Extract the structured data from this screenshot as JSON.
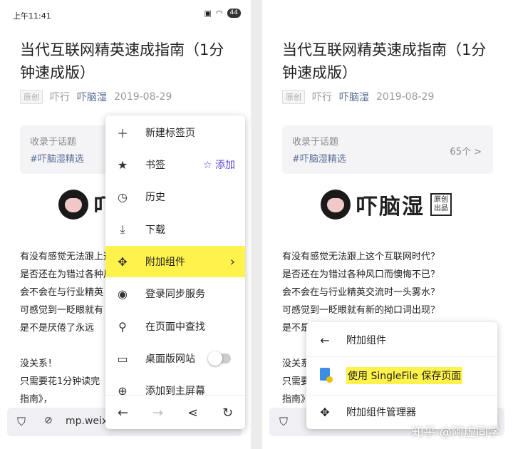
{
  "status": {
    "time": "上午11:41",
    "battery": "44"
  },
  "article": {
    "title": "当代互联网精英速成指南（1分钟速成版）",
    "tag": "原创",
    "author_label": "吓行",
    "author": "吓脑湿",
    "date": "2019-08-29",
    "topic_label": "收录于话题",
    "topic": "#吓脑湿精选",
    "topic_count": "65个 >",
    "logo_text": "吓脑湿",
    "logo_sub": "原创出品",
    "lines_left": [
      "有没有感觉无法跟上这个互联网时代?",
      "是否还在为错过各种风",
      "会不会在与行业精英",
      "可感觉到一眨眼就有",
      "是不是厌倦了永远",
      "",
      "没关系！",
      "只需要花1分钟读完",
      "指南》，"
    ],
    "lines_right": [
      "有没有感觉无法跟上这个互联网时代？",
      "是否还在为错过各种风口而懊悔不已？",
      "会不会在与行业精英交流时一头雾水？",
      "可感觉到一眨眼就有新的拗口词出现？",
      "是不是厌",
      "",
      "没关系！",
      "只需要",
      "指南》，"
    ]
  },
  "urlbar": {
    "url": "mp.weix"
  },
  "menu": {
    "items": [
      {
        "label": "新建标签页",
        "icon": "plus-icon"
      },
      {
        "label": "书签",
        "icon": "star-icon",
        "action": "添加"
      },
      {
        "label": "历史",
        "icon": "clock-icon"
      },
      {
        "label": "下载",
        "icon": "download-icon"
      },
      {
        "label": "附加组件",
        "icon": "puzzle-icon"
      },
      {
        "label": "登录同步服务",
        "icon": "account-icon"
      },
      {
        "label": "在页面中查找",
        "icon": "search-icon"
      },
      {
        "label": "桌面版网站",
        "icon": "laptop-icon"
      },
      {
        "label": "添加到主屏幕",
        "icon": "add-home-icon"
      }
    ]
  },
  "submenu": {
    "back_label": "附加组件",
    "singlefile_label": "使用 SingleFile 保存页面",
    "manager_label": "附加组件管理器"
  },
  "watermark": "知乎 @阿虚同学",
  "colors": {
    "highlight": "#fff24a",
    "link": "#576b95",
    "accent": "#5b3fd6"
  }
}
